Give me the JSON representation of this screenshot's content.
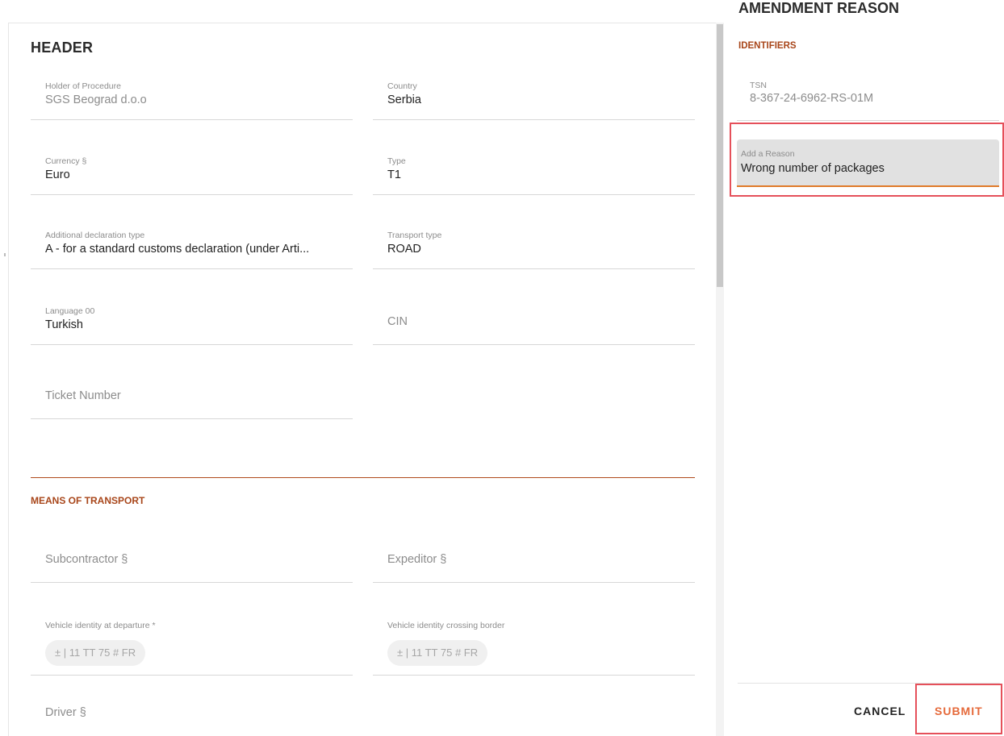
{
  "form": {
    "section_title": "HEADER",
    "fields": {
      "holder": {
        "label": "Holder of Procedure",
        "value": "SGS Beograd d.o.o"
      },
      "country": {
        "label": "Country",
        "value": "Serbia"
      },
      "currency": {
        "label": "Currency §",
        "value": "Euro"
      },
      "type": {
        "label": "Type",
        "value": "T1"
      },
      "additional_declaration_type": {
        "label": "Additional declaration type",
        "value": "A - for a standard customs declaration (under Arti..."
      },
      "transport_type": {
        "label": "Transport type",
        "value": "ROAD"
      },
      "language": {
        "label": "Language 00",
        "value": "Turkish"
      },
      "cin": {
        "placeholder": "CIN"
      },
      "ticket_number": {
        "placeholder": "Ticket Number"
      }
    },
    "means_of_transport": {
      "title": "MEANS OF TRANSPORT",
      "subcontractor": {
        "placeholder": "Subcontractor §"
      },
      "expeditor": {
        "placeholder": "Expeditor §"
      },
      "vehicle_departure": {
        "label": "Vehicle identity at departure *",
        "chip": "± | 11 TT 75 # FR"
      },
      "vehicle_border": {
        "label": "Vehicle identity crossing border",
        "chip": "± | 11 TT 75 # FR"
      },
      "driver": {
        "placeholder": "Driver §"
      }
    }
  },
  "amendment": {
    "title": "AMENDMENT REASON",
    "identifiers_title": "IDENTIFIERS",
    "tsn": {
      "label": "TSN",
      "value": "8-367-24-6962-RS-01M"
    },
    "reason": {
      "label": "Add a Reason",
      "value": "Wrong number of packages"
    },
    "cancel_label": "CANCEL",
    "submit_label": "SUBMIT"
  },
  "colors": {
    "accent": "#a8461a",
    "submit": "#e5693a",
    "focus_underline": "#e07a2a",
    "highlight": "#e5505a"
  }
}
